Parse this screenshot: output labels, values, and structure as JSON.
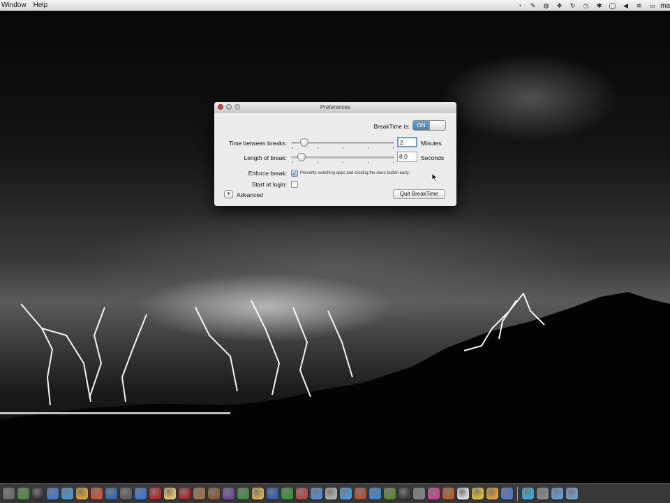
{
  "menubar": {
    "items": [
      "Window",
      "Help"
    ],
    "status_icons": [
      "timer-icon",
      "script-icon",
      "globe-icon",
      "dropbox-icon",
      "sync-icon",
      "time-machine-icon",
      "bluetooth-icon",
      "chat-icon",
      "volume-icon",
      "wifi-icon",
      "battery-icon"
    ],
    "user": "ma"
  },
  "window": {
    "title": "Preferences",
    "breaktime_label": "BreakTime is:",
    "toggle_state": "ON",
    "time_between_label": "Time between breaks:",
    "time_between_value": "2",
    "time_between_unit": "Minutes",
    "time_between_slider_fraction": 0.13,
    "length_label": "Length of break:",
    "length_value": "8.0",
    "length_unit": "Seconds",
    "length_slider_fraction": 0.1,
    "enforce_label": "Enforce break:",
    "enforce_checked": true,
    "enforce_description": "Prevents switching apps and clicking the done button early.",
    "start_label": "Start at login:",
    "start_checked": false,
    "advanced_label": "Advanced",
    "quit_label": "Quit BreakTime"
  },
  "dock": {
    "colors": [
      "#6a6a6a",
      "#4a8a3a",
      "#333333",
      "#3a7ad8",
      "#3a9ad8",
      "#e0a020",
      "#d84a2a",
      "#2a6ab8",
      "#5a5a5a",
      "#2a7ae0",
      "#c02020",
      "#e8c860",
      "#b02020",
      "#a07040",
      "#8a5a2a",
      "#6a4aa0",
      "#3a8a3a",
      "#d8b040",
      "#2a5ac0",
      "#2a9a2a",
      "#c04040",
      "#4a8ad8",
      "#b0b0b0",
      "#3aa0e0",
      "#c04a2a",
      "#2a8ae0",
      "#5a8a2a",
      "#3a3a3a",
      "#808080",
      "#d04090",
      "#c05a20",
      "#e0e0e0",
      "#e0c020",
      "#e8a020",
      "#4a7ad8",
      "#2ab0e0",
      "#8a8a8a",
      "#5aa0e0",
      "#70a0d0"
    ]
  }
}
